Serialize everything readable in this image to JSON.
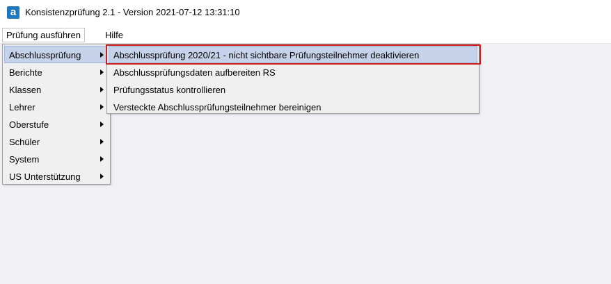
{
  "window": {
    "title": "Konsistenzprüfung 2.1 - Version 2021-07-12 13:31:10",
    "icon": "a",
    "icon_color": "#1c78c0"
  },
  "menubar": {
    "items": [
      {
        "label": "Prüfung ausführen",
        "state": "open"
      },
      {
        "label": "Hilfe"
      }
    ]
  },
  "main_menu": {
    "items": [
      {
        "label": "Abschlussprüfung",
        "selected": true
      },
      {
        "label": "Berichte"
      },
      {
        "label": "Klassen"
      },
      {
        "label": "Lehrer"
      },
      {
        "label": "Oberstufe"
      },
      {
        "label": "Schüler"
      },
      {
        "label": "System"
      },
      {
        "label": "US Unterstützung"
      }
    ]
  },
  "submenu": {
    "items": [
      {
        "label": "Abschlussprüfung 2020/21 - nicht sichtbare Prüfungsteilnehmer deaktivieren",
        "selected": true,
        "highlight_color": "#d01b1b"
      },
      {
        "label": "Abschlussprüfungsdaten aufbereiten RS"
      },
      {
        "label": "Prüfungsstatus kontrollieren"
      },
      {
        "label": "Versteckte Abschlussprüfungsteilnehmer bereinigen"
      }
    ]
  }
}
